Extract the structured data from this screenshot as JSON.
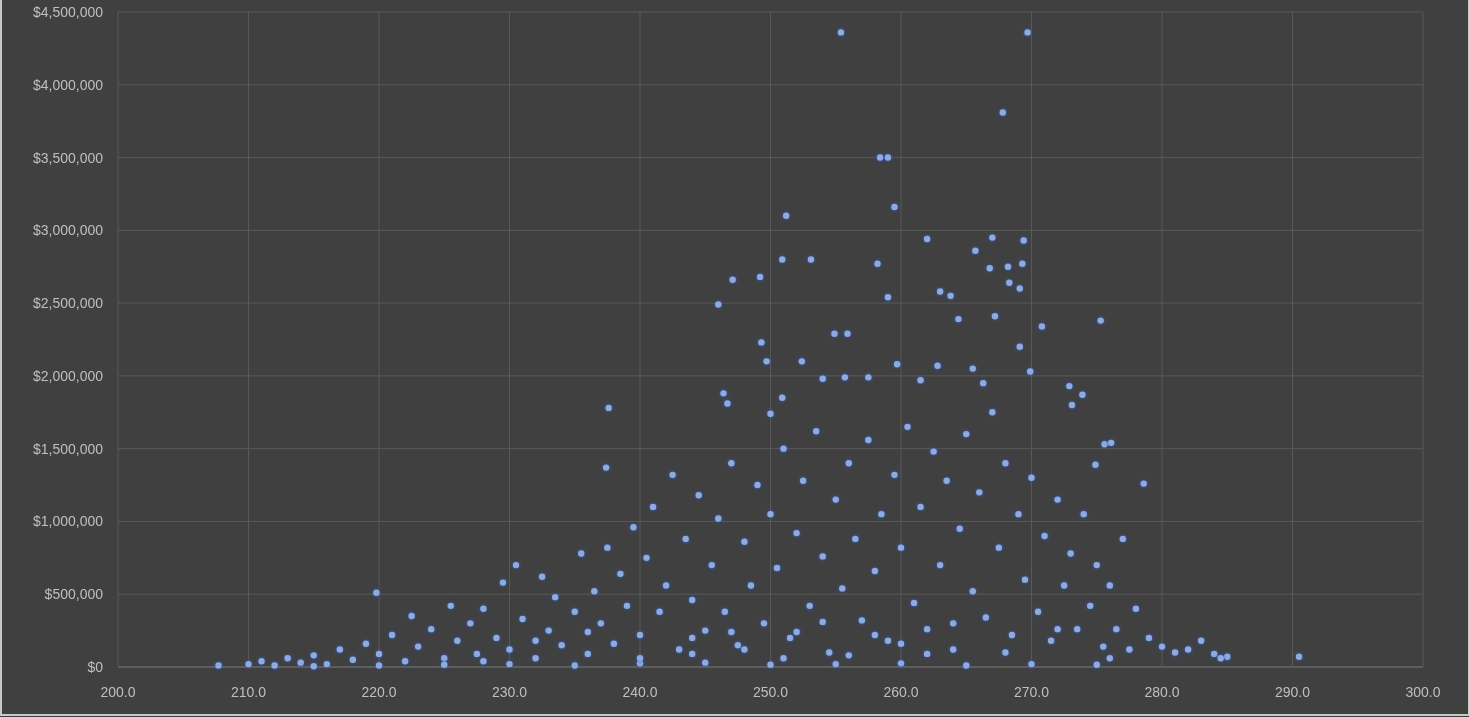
{
  "chart": {
    "chart_data": {
      "type": "scatter",
      "grid": true,
      "xlim": [
        200,
        300
      ],
      "ylim": [
        0,
        4500000
      ],
      "xticks": [
        {
          "value": 200,
          "label": "200.0"
        },
        {
          "value": 210,
          "label": "210.0"
        },
        {
          "value": 220,
          "label": "220.0"
        },
        {
          "value": 230,
          "label": "230.0"
        },
        {
          "value": 240,
          "label": "240.0"
        },
        {
          "value": 250,
          "label": "250.0"
        },
        {
          "value": 260,
          "label": "260.0"
        },
        {
          "value": 270,
          "label": "270.0"
        },
        {
          "value": 280,
          "label": "280.0"
        },
        {
          "value": 290,
          "label": "290.0"
        },
        {
          "value": 300,
          "label": "300.0"
        }
      ],
      "yticks": [
        {
          "value": 0,
          "label": "$0"
        },
        {
          "value": 500000,
          "label": "$500,000"
        },
        {
          "value": 1000000,
          "label": "$1,000,000"
        },
        {
          "value": 1500000,
          "label": "$1,500,000"
        },
        {
          "value": 2000000,
          "label": "$2,000,000"
        },
        {
          "value": 2500000,
          "label": "$2,500,000"
        },
        {
          "value": 3000000,
          "label": "$3,000,000"
        },
        {
          "value": 3500000,
          "label": "$3,500,000"
        },
        {
          "value": 4000000,
          "label": "$4,000,000"
        },
        {
          "value": 4500000,
          "label": "$4,500,000"
        }
      ],
      "x": [
        255.4,
        269.7,
        267.8,
        258.4,
        259.0,
        259.5,
        251.2,
        258.2,
        250.9,
        253.1,
        247.1,
        249.2,
        246.0,
        259.0,
        262.0,
        267.0,
        269.4,
        265.7,
        266.8,
        268.2,
        269.3,
        268.3,
        269.1,
        263.0,
        263.8,
        264.4,
        267.2,
        270.8,
        275.3,
        254.9,
        255.9,
        249.3,
        249.7,
        252.4,
        269.1,
        269.9,
        254.0,
        255.7,
        257.5,
        259.7,
        261.5,
        262.8,
        265.5,
        266.3,
        272.9,
        273.9,
        237.6,
        237.4,
        246.4,
        246.7,
        250.9,
        250.0,
        273.1,
        278.6,
        275.6,
        276.1,
        274.9,
        290.5,
        285.0,
        207.7,
        219.8,
        210,
        211,
        212,
        213,
        214,
        215,
        216,
        217,
        218,
        219,
        220,
        221,
        222,
        222.5,
        223,
        224,
        225,
        225.5,
        226,
        227,
        227.5,
        228,
        229,
        229.5,
        230,
        230.5,
        231,
        232,
        232.5,
        233,
        233.5,
        234,
        235,
        235.5,
        236,
        236.5,
        237,
        237.5,
        238,
        238.5,
        239,
        239.5,
        240,
        240.5,
        241,
        241.5,
        242,
        242.5,
        243,
        243.5,
        244,
        244.5,
        245,
        245.5,
        246,
        246.5,
        247,
        247.5,
        248,
        248.5,
        249,
        249.5,
        250,
        250.5,
        251,
        251.5,
        252,
        252.5,
        253,
        253.5,
        254,
        254.5,
        255,
        255.5,
        256,
        256.5,
        257,
        257.5,
        258,
        258.5,
        259,
        259.5,
        260,
        260.5,
        261,
        261.5,
        262,
        262.5,
        263,
        263.5,
        264,
        264.5,
        265,
        265.5,
        266,
        266.5,
        267,
        267.5,
        268,
        268.5,
        269,
        269.5,
        270,
        270.5,
        271,
        271.5,
        272,
        272.5,
        273,
        273.5,
        274,
        274.5,
        275,
        275.5,
        276,
        276.5,
        277,
        277.5,
        278,
        279,
        280,
        281,
        282,
        283,
        284,
        284.5,
        215,
        220,
        225,
        230,
        235,
        240,
        245,
        250,
        255,
        260,
        265,
        270,
        275,
        228,
        232,
        236,
        240,
        244,
        248,
        252,
        256,
        260,
        264,
        268,
        272,
        276,
        244,
        247,
        251,
        254,
        258,
        262
      ],
      "series": [
        {
          "color": "#8faadc",
          "values": [
            4360000,
            4360000,
            3810000,
            3500000,
            3500000,
            3160000,
            3100000,
            2770000,
            2800000,
            2800000,
            2660000,
            2680000,
            2490000,
            2540000,
            2940000,
            2950000,
            2930000,
            2860000,
            2740000,
            2750000,
            2770000,
            2640000,
            2600000,
            2580000,
            2550000,
            2390000,
            2410000,
            2340000,
            2380000,
            2290000,
            2290000,
            2230000,
            2100000,
            2100000,
            2200000,
            2030000,
            1980000,
            1990000,
            1990000,
            2080000,
            1970000,
            2070000,
            2050000,
            1950000,
            1930000,
            1870000,
            1780000,
            1370000,
            1880000,
            1810000,
            1850000,
            1740000,
            1800000,
            1260000,
            1530000,
            1540000,
            1390000,
            70000,
            70000,
            10000,
            510000,
            20000,
            40000,
            10000,
            60000,
            30000,
            80000,
            20000,
            120000,
            50000,
            160000,
            90000,
            220000,
            40000,
            350000,
            140000,
            260000,
            60000,
            420000,
            180000,
            300000,
            90000,
            400000,
            200000,
            580000,
            120000,
            700000,
            330000,
            60000,
            620000,
            250000,
            480000,
            150000,
            380000,
            780000,
            90000,
            520000,
            300000,
            820000,
            160000,
            640000,
            420000,
            960000,
            220000,
            750000,
            1100000,
            380000,
            560000,
            1320000,
            120000,
            880000,
            460000,
            1180000,
            250000,
            700000,
            1020000,
            380000,
            1400000,
            150000,
            860000,
            560000,
            1250000,
            300000,
            1050000,
            680000,
            1500000,
            200000,
            920000,
            1280000,
            420000,
            1620000,
            760000,
            100000,
            1150000,
            540000,
            1400000,
            880000,
            320000,
            1560000,
            660000,
            1050000,
            180000,
            1320000,
            820000,
            1650000,
            440000,
            1100000,
            260000,
            1480000,
            700000,
            1280000,
            120000,
            950000,
            1600000,
            520000,
            1200000,
            340000,
            1750000,
            820000,
            1400000,
            220000,
            1050000,
            600000,
            1300000,
            380000,
            900000,
            180000,
            1150000,
            560000,
            780000,
            260000,
            1050000,
            420000,
            700000,
            140000,
            560000,
            260000,
            880000,
            120000,
            400000,
            200000,
            140000,
            100000,
            120000,
            180000,
            90000,
            60000,
            5000,
            10000,
            15000,
            20000,
            10000,
            25000,
            30000,
            15000,
            20000,
            25000,
            10000,
            20000,
            15000,
            40000,
            180000,
            240000,
            60000,
            200000,
            120000,
            240000,
            80000,
            160000,
            300000,
            100000,
            260000,
            60000,
            90000,
            240000,
            60000,
            310000,
            220000,
            90000
          ]
        }
      ]
    }
  }
}
